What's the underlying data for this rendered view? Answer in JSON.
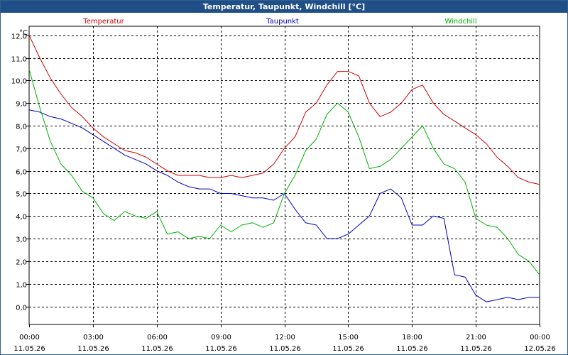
{
  "window": {
    "title": "Temperatur, Taupunkt, Windchill [°C]"
  },
  "chart_data": {
    "type": "line",
    "title": "Temperatur, Taupunkt, Windchill [°C]",
    "ylabel": "°C",
    "xlabel": "",
    "ylim": [
      -0.8,
      12.4
    ],
    "xlim": [
      0,
      24
    ],
    "grid": true,
    "legend_placement": "top",
    "y_ticks": [
      "12,0",
      "11,0",
      "10,0",
      "9,0",
      "8,0",
      "7,0",
      "6,0",
      "5,0",
      "4,0",
      "3,0",
      "2,0",
      "1,0",
      "0,0"
    ],
    "x_ticks": [
      {
        "time": "00:00",
        "date": "11.05.26"
      },
      {
        "time": "03:00",
        "date": "11.05.26"
      },
      {
        "time": "06:00",
        "date": "11.05.26"
      },
      {
        "time": "09:00",
        "date": "11.05.26"
      },
      {
        "time": "12:00",
        "date": "11.05.26"
      },
      {
        "time": "15:00",
        "date": "11.05.26"
      },
      {
        "time": "18:00",
        "date": "11.05.26"
      },
      {
        "time": "21:00",
        "date": "11.05.26"
      },
      {
        "time": "00:00",
        "date": "12.05.26"
      }
    ],
    "series": [
      {
        "name": "Temperatur",
        "color": "#d00000",
        "points": [
          [
            0,
            12.0
          ],
          [
            0.5,
            11.0
          ],
          [
            1,
            10.1
          ],
          [
            1.5,
            9.4
          ],
          [
            2,
            8.8
          ],
          [
            2.5,
            8.4
          ],
          [
            3,
            7.9
          ],
          [
            3.5,
            7.5
          ],
          [
            4,
            7.2
          ],
          [
            4.5,
            6.9
          ],
          [
            5,
            6.8
          ],
          [
            5.5,
            6.6
          ],
          [
            6,
            6.3
          ],
          [
            6.5,
            6.0
          ],
          [
            7,
            5.8
          ],
          [
            7.5,
            5.8
          ],
          [
            8,
            5.8
          ],
          [
            8.5,
            5.7
          ],
          [
            9,
            5.7
          ],
          [
            9.5,
            5.8
          ],
          [
            10,
            5.7
          ],
          [
            10.5,
            5.8
          ],
          [
            11,
            5.9
          ],
          [
            11.5,
            6.3
          ],
          [
            12,
            7.0
          ],
          [
            12.5,
            7.5
          ],
          [
            13,
            8.6
          ],
          [
            13.5,
            9.0
          ],
          [
            14,
            9.8
          ],
          [
            14.5,
            10.4
          ],
          [
            15,
            10.4
          ],
          [
            15.5,
            10.2
          ],
          [
            16,
            9.0
          ],
          [
            16.5,
            8.4
          ],
          [
            17,
            8.6
          ],
          [
            17.5,
            9.0
          ],
          [
            18,
            9.6
          ],
          [
            18.5,
            9.8
          ],
          [
            19,
            9.0
          ],
          [
            19.5,
            8.5
          ],
          [
            20,
            8.2
          ],
          [
            20.5,
            7.9
          ],
          [
            21,
            7.6
          ],
          [
            21.5,
            7.2
          ],
          [
            22,
            6.6
          ],
          [
            22.5,
            6.2
          ],
          [
            23,
            5.7
          ],
          [
            23.5,
            5.5
          ],
          [
            24,
            5.4
          ]
        ]
      },
      {
        "name": "Taupunkt",
        "color": "#0000c0",
        "points": [
          [
            0,
            8.7
          ],
          [
            0.5,
            8.6
          ],
          [
            1,
            8.4
          ],
          [
            1.5,
            8.3
          ],
          [
            2,
            8.1
          ],
          [
            2.5,
            7.9
          ],
          [
            3,
            7.6
          ],
          [
            3.5,
            7.3
          ],
          [
            4,
            7.0
          ],
          [
            4.5,
            6.7
          ],
          [
            5,
            6.5
          ],
          [
            5.5,
            6.3
          ],
          [
            6,
            6.0
          ],
          [
            6.5,
            5.8
          ],
          [
            7,
            5.5
          ],
          [
            7.5,
            5.3
          ],
          [
            8,
            5.2
          ],
          [
            8.5,
            5.2
          ],
          [
            9,
            5.0
          ],
          [
            9.5,
            5.0
          ],
          [
            10,
            4.9
          ],
          [
            10.5,
            4.8
          ],
          [
            11,
            4.8
          ],
          [
            11.5,
            4.7
          ],
          [
            12,
            5.0
          ],
          [
            12.5,
            4.3
          ],
          [
            13,
            3.7
          ],
          [
            13.5,
            3.6
          ],
          [
            14,
            3.0
          ],
          [
            14.5,
            3.0
          ],
          [
            15,
            3.2
          ],
          [
            15.5,
            3.6
          ],
          [
            16,
            4.0
          ],
          [
            16.5,
            5.0
          ],
          [
            17,
            5.2
          ],
          [
            17.5,
            4.8
          ],
          [
            18,
            3.6
          ],
          [
            18.5,
            3.6
          ],
          [
            19,
            4.0
          ],
          [
            19.5,
            3.9
          ],
          [
            20,
            1.4
          ],
          [
            20.5,
            1.3
          ],
          [
            21,
            0.5
          ],
          [
            21.5,
            0.2
          ],
          [
            22,
            0.3
          ],
          [
            22.5,
            0.4
          ],
          [
            23,
            0.3
          ],
          [
            23.5,
            0.4
          ],
          [
            24,
            0.4
          ]
        ]
      },
      {
        "name": "Windchill",
        "color": "#00b000",
        "points": [
          [
            0,
            10.5
          ],
          [
            0.5,
            8.8
          ],
          [
            1,
            7.3
          ],
          [
            1.5,
            6.3
          ],
          [
            2,
            5.8
          ],
          [
            2.5,
            5.1
          ],
          [
            3,
            4.8
          ],
          [
            3.5,
            4.1
          ],
          [
            4,
            3.8
          ],
          [
            4.5,
            4.2
          ],
          [
            5,
            4.0
          ],
          [
            5.5,
            3.9
          ],
          [
            6,
            4.2
          ],
          [
            6.5,
            3.2
          ],
          [
            7,
            3.3
          ],
          [
            7.5,
            3.0
          ],
          [
            8,
            3.1
          ],
          [
            8.5,
            3.0
          ],
          [
            9,
            3.6
          ],
          [
            9.5,
            3.3
          ],
          [
            10,
            3.6
          ],
          [
            10.5,
            3.7
          ],
          [
            11,
            3.5
          ],
          [
            11.5,
            3.7
          ],
          [
            12,
            5.0
          ],
          [
            12.5,
            5.8
          ],
          [
            13,
            6.9
          ],
          [
            13.5,
            7.4
          ],
          [
            14,
            8.5
          ],
          [
            14.5,
            9.0
          ],
          [
            15,
            8.6
          ],
          [
            15.5,
            7.5
          ],
          [
            16,
            6.1
          ],
          [
            16.5,
            6.2
          ],
          [
            17,
            6.5
          ],
          [
            17.5,
            7.0
          ],
          [
            18,
            7.5
          ],
          [
            18.5,
            8.0
          ],
          [
            19,
            7.0
          ],
          [
            19.5,
            6.3
          ],
          [
            20,
            6.1
          ],
          [
            20.5,
            5.5
          ],
          [
            21,
            3.9
          ],
          [
            21.5,
            3.6
          ],
          [
            22,
            3.5
          ],
          [
            22.5,
            3.0
          ],
          [
            23,
            2.3
          ],
          [
            23.5,
            2.0
          ],
          [
            24,
            1.4
          ]
        ]
      }
    ]
  }
}
